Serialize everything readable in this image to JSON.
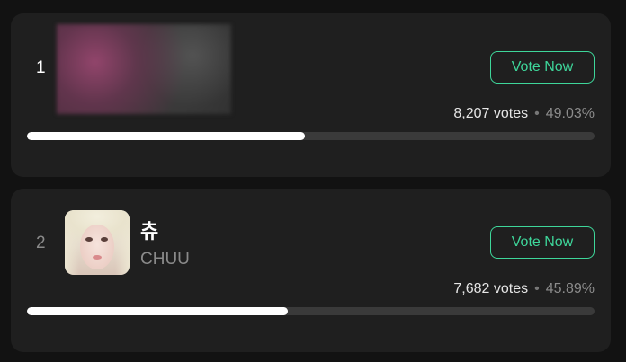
{
  "candidates": [
    {
      "rank": "1",
      "name": "",
      "subname": "",
      "vote_label": "Vote Now",
      "votes": "8,207 votes",
      "separator": "•",
      "percent": "49.03%",
      "fraction": 0.4903
    },
    {
      "rank": "2",
      "name": "츄",
      "subname": "CHUU",
      "vote_label": "Vote Now",
      "votes": "7,682 votes",
      "separator": "•",
      "percent": "45.89%",
      "fraction": 0.4589
    }
  ],
  "colors": {
    "accent": "#3ed69a",
    "card": "#1f1f1f",
    "background": "#121212",
    "bar_fill": "#ffffff",
    "bar_track": "#3a3a3a"
  }
}
